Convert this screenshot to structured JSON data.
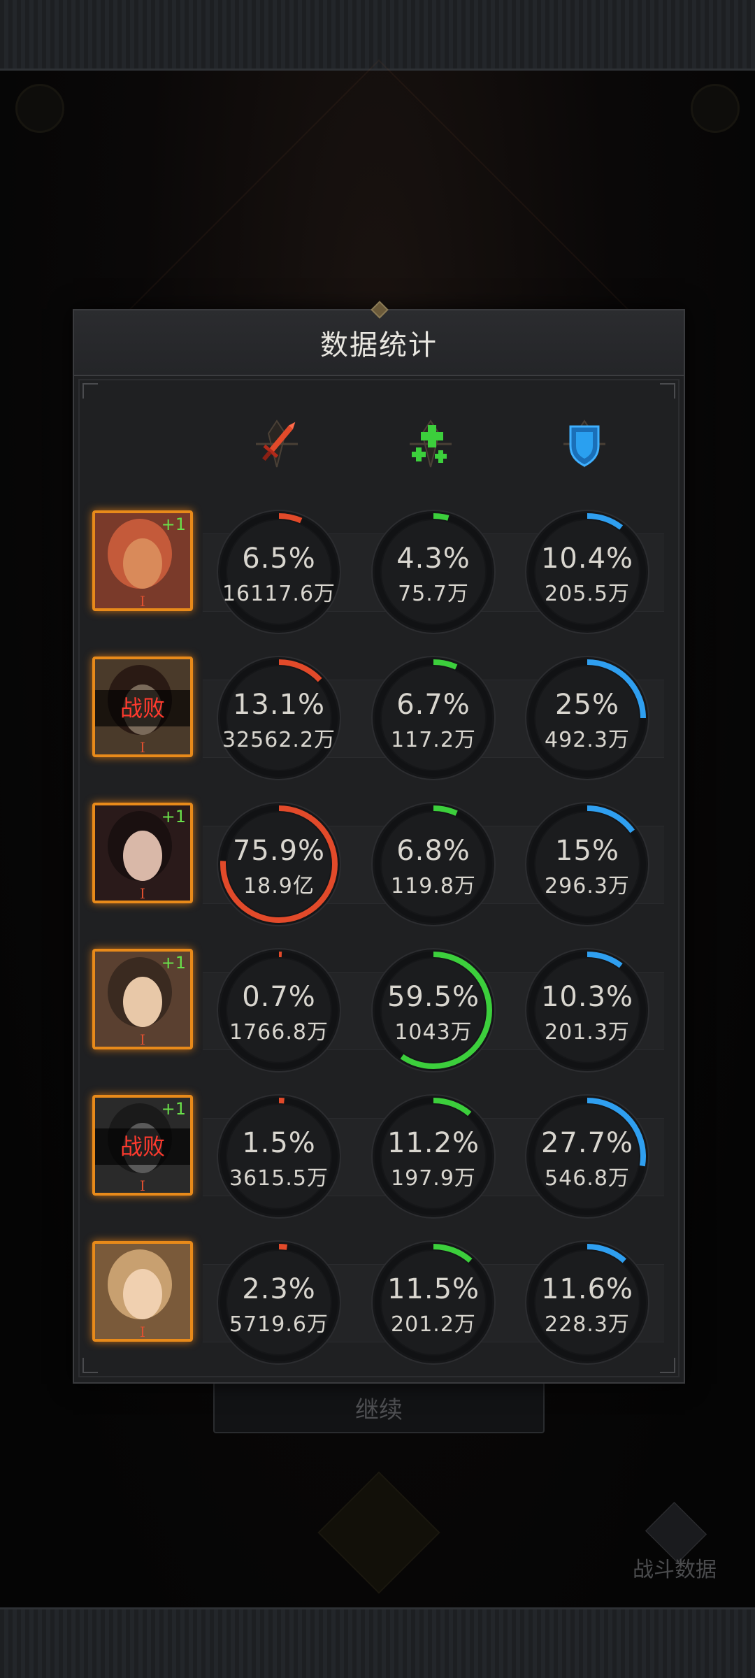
{
  "modal": {
    "title": "数据统计"
  },
  "columns": [
    {
      "name": "damage",
      "icon": "sword-icon",
      "color": "#e24a2a"
    },
    {
      "name": "heal",
      "icon": "heal-cross-icon",
      "color": "#3ccf3c"
    },
    {
      "name": "defense",
      "icon": "shield-icon",
      "color": "#2f9ff0"
    }
  ],
  "rows": [
    {
      "plus": "+1",
      "defeated": "",
      "rank": "I",
      "damage": {
        "pct": "6.5%",
        "amt": "16117.6万",
        "frac": 0.065
      },
      "heal": {
        "pct": "4.3%",
        "amt": "75.7万",
        "frac": 0.043
      },
      "defense": {
        "pct": "10.4%",
        "amt": "205.5万",
        "frac": 0.104
      }
    },
    {
      "plus": "",
      "defeated": "战败",
      "rank": "I",
      "damage": {
        "pct": "13.1%",
        "amt": "32562.2万",
        "frac": 0.131
      },
      "heal": {
        "pct": "6.7%",
        "amt": "117.2万",
        "frac": 0.067
      },
      "defense": {
        "pct": "25%",
        "amt": "492.3万",
        "frac": 0.25
      }
    },
    {
      "plus": "+1",
      "defeated": "",
      "rank": "I",
      "damage": {
        "pct": "75.9%",
        "amt": "18.9亿",
        "frac": 0.759
      },
      "heal": {
        "pct": "6.8%",
        "amt": "119.8万",
        "frac": 0.068
      },
      "defense": {
        "pct": "15%",
        "amt": "296.3万",
        "frac": 0.15
      }
    },
    {
      "plus": "+1",
      "defeated": "",
      "rank": "I",
      "damage": {
        "pct": "0.7%",
        "amt": "1766.8万",
        "frac": 0.007
      },
      "heal": {
        "pct": "59.5%",
        "amt": "1043万",
        "frac": 0.595
      },
      "defense": {
        "pct": "10.3%",
        "amt": "201.3万",
        "frac": 0.103
      }
    },
    {
      "plus": "+1",
      "defeated": "战败",
      "rank": "I",
      "damage": {
        "pct": "1.5%",
        "amt": "3615.5万",
        "frac": 0.015
      },
      "heal": {
        "pct": "11.2%",
        "amt": "197.9万",
        "frac": 0.112
      },
      "defense": {
        "pct": "27.7%",
        "amt": "546.8万",
        "frac": 0.277
      }
    },
    {
      "plus": "",
      "defeated": "",
      "rank": "I",
      "damage": {
        "pct": "2.3%",
        "amt": "5719.6万",
        "frac": 0.023
      },
      "heal": {
        "pct": "11.5%",
        "amt": "201.2万",
        "frac": 0.115
      },
      "defense": {
        "pct": "11.6%",
        "amt": "228.3万",
        "frac": 0.116
      }
    }
  ],
  "continue_label": "继续",
  "battle_data_label": "战斗数据",
  "colors": {
    "avatar_border": "#e88a1a",
    "defeat_text": "#ff3a2e",
    "plus_text": "#6ae04a",
    "ring_track": "#111214"
  }
}
